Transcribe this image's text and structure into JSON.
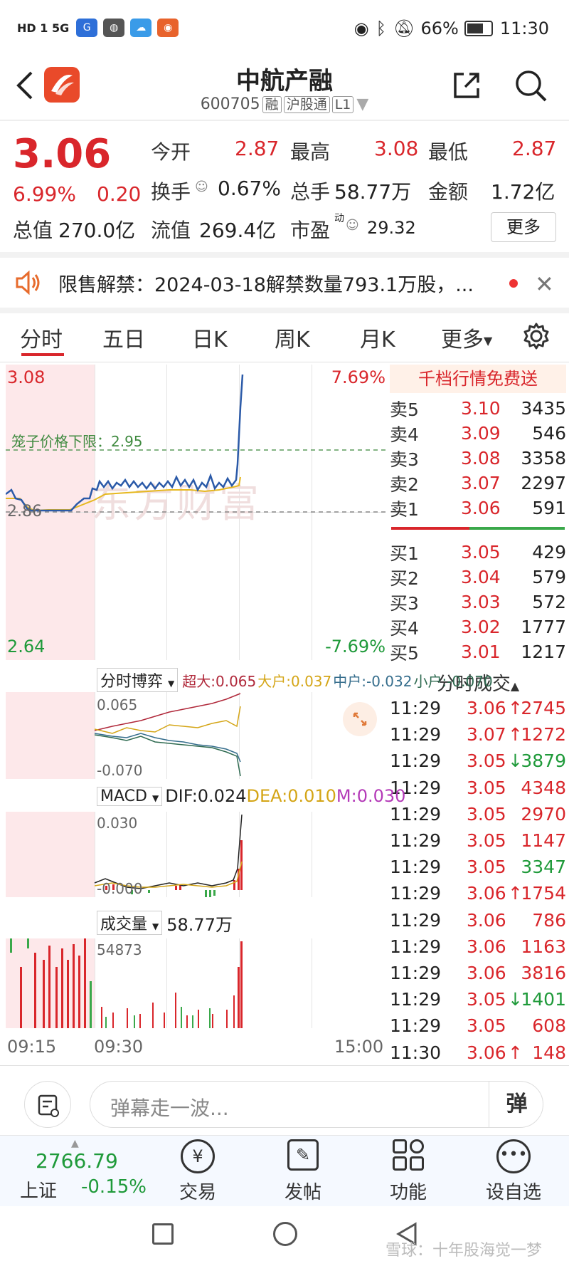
{
  "status_bar": {
    "left_text": "HD 1 5G",
    "battery": "66%",
    "time": "11:30"
  },
  "header": {
    "name": "中航产融",
    "code": "600705",
    "tags": [
      "融",
      "沪股通",
      "L1"
    ]
  },
  "quote": {
    "price": "3.06",
    "change_pct": "6.99%",
    "change": "0.20",
    "open_label": "今开",
    "open": "2.87",
    "high_label": "最高",
    "high": "3.08",
    "low_label": "最低",
    "low": "2.87",
    "turnover_label": "换手",
    "turnover": "0.67%",
    "volume_label": "总手",
    "volume": "58.77万",
    "amount_label": "金额",
    "amount": "1.72亿",
    "mktcap_label": "总值",
    "mktcap": "270.0亿",
    "float_label": "流值",
    "float_cap": "269.4亿",
    "pe_label": "市盈",
    "pe_sup": "动",
    "pe": "29.32",
    "more_button": "更多"
  },
  "notice": {
    "text": "限售解禁：2024-03-18解禁数量793.1万股，..."
  },
  "tabs": [
    "分时",
    "五日",
    "日K",
    "周K",
    "月K",
    "更多"
  ],
  "intraday": {
    "y_top": "3.08",
    "y_bottom": "2.64",
    "y_mid": "2.86",
    "pct_top": "7.69%",
    "pct_bottom": "-7.69%",
    "cage_label": "笼子价格下限：2.95",
    "watermark": "东方财富"
  },
  "orderbook": {
    "header": "千档行情免费送",
    "asks": [
      {
        "label": "卖5",
        "price": "3.10",
        "vol": "3435"
      },
      {
        "label": "卖4",
        "price": "3.09",
        "vol": "546"
      },
      {
        "label": "卖3",
        "price": "3.08",
        "vol": "3358"
      },
      {
        "label": "卖2",
        "price": "3.07",
        "vol": "2297"
      },
      {
        "label": "卖1",
        "price": "3.06",
        "vol": "591"
      }
    ],
    "bids": [
      {
        "label": "买1",
        "price": "3.05",
        "vol": "429"
      },
      {
        "label": "买2",
        "price": "3.04",
        "vol": "579"
      },
      {
        "label": "买3",
        "price": "3.03",
        "vol": "572"
      },
      {
        "label": "买4",
        "price": "3.02",
        "vol": "1777"
      },
      {
        "label": "买5",
        "price": "3.01",
        "vol": "1217"
      }
    ]
  },
  "trades": {
    "header": "分时成交",
    "rows": [
      {
        "time": "11:29",
        "price": "3.06",
        "vol": "2745",
        "dir": "↑",
        "color": "#d9262b"
      },
      {
        "time": "11:29",
        "price": "3.07",
        "vol": "1272",
        "dir": "↑",
        "color": "#d9262b"
      },
      {
        "time": "11:29",
        "price": "3.05",
        "vol": "3879",
        "dir": "↓",
        "color": "#1f9a3a"
      },
      {
        "time": "11:29",
        "price": "3.05",
        "vol": "4348",
        "dir": "",
        "color": "#d9262b"
      },
      {
        "time": "11:29",
        "price": "3.05",
        "vol": "2970",
        "dir": "",
        "color": "#d9262b"
      },
      {
        "time": "11:29",
        "price": "3.05",
        "vol": "1147",
        "dir": "",
        "color": "#d9262b"
      },
      {
        "time": "11:29",
        "price": "3.05",
        "vol": "3347",
        "dir": "",
        "color": "#1f9a3a"
      },
      {
        "time": "11:29",
        "price": "3.06",
        "vol": "1754",
        "dir": "↑",
        "color": "#d9262b"
      },
      {
        "time": "11:29",
        "price": "3.06",
        "vol": "786",
        "dir": "",
        "color": "#d9262b"
      },
      {
        "time": "11:29",
        "price": "3.06",
        "vol": "1163",
        "dir": "",
        "color": "#d9262b"
      },
      {
        "time": "11:29",
        "price": "3.06",
        "vol": "3816",
        "dir": "",
        "color": "#d9262b"
      },
      {
        "time": "11:29",
        "price": "3.05",
        "vol": "1401",
        "dir": "↓",
        "color": "#1f9a3a"
      },
      {
        "time": "11:29",
        "price": "3.05",
        "vol": "608",
        "dir": "",
        "color": "#d9262b"
      },
      {
        "time": "11:30",
        "price": "3.06",
        "vol": "148",
        "dir": "↑",
        "color": "#d9262b"
      }
    ]
  },
  "flow": {
    "selector": "分时博弈",
    "super_label": "超大:0.065",
    "large_label": "大户:0.037",
    "mid_label": "中户:-0.032",
    "small_label": "小户:-0.070",
    "y_top": "0.065",
    "y_bottom": "-0.070"
  },
  "macd": {
    "selector": "MACD",
    "dif": "DIF:0.024",
    "dea": "DEA:0.010",
    "m": "M:0.030",
    "y_top": "0.030",
    "y_bottom": "-0.000"
  },
  "volume": {
    "selector": "成交量",
    "total": "58.77万",
    "y_top": "54873"
  },
  "time_axis": [
    "09:15",
    "09:30",
    "15:00"
  ],
  "comment": {
    "placeholder": "弹幕走一波...",
    "danmu_button": "弹"
  },
  "bottom_nav": {
    "index_value": "2766.79",
    "index_name": "上证",
    "index_change": "-0.15%",
    "items": [
      "交易",
      "发帖",
      "功能",
      "设自选"
    ]
  },
  "watermark_footer": "雪球：十年股海觉一梦",
  "colors": {
    "up": "#d9262b",
    "down": "#1f9a3a",
    "price_line": "#2b5aa8",
    "avg_line": "#e6b820"
  }
}
